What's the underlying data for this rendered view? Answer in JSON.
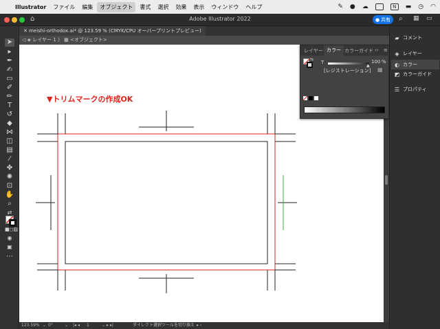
{
  "menubar": {
    "app": "Illustrator",
    "items": [
      "ファイル",
      "編集",
      "オブジェクト",
      "書式",
      "選択",
      "効果",
      "表示",
      "ウィンドウ",
      "ヘルプ"
    ],
    "active_index": 2
  },
  "window": {
    "title": "Adobe Illustrator 2022",
    "share_label": "共有"
  },
  "document": {
    "tab_label": "meishi-orthodox.ai* @ 123.59 % (CMYK/CPU オーバープリントプレビュー)",
    "breadcrumb_layer": "レイヤー 1",
    "breadcrumb_object": "<オブジェクト>"
  },
  "canvas": {
    "annotation": "▼トリムマークの作成OK"
  },
  "color_panel": {
    "tabs": [
      "レイヤー",
      "カラー",
      "カラーガイド"
    ],
    "selected_tab": "カラー",
    "channel_label": "T",
    "value": "100",
    "unit": "%",
    "registration_label": "[レジストレーション]"
  },
  "dock": {
    "items": [
      {
        "label": "コメント",
        "icon": "comment-icon"
      },
      {
        "label": "レイヤー",
        "icon": "layers-icon"
      },
      {
        "label": "カラー",
        "icon": "color-icon"
      },
      {
        "label": "カラーガイド",
        "icon": "color-guide-icon"
      },
      {
        "label": "プロパティ",
        "icon": "properties-icon"
      }
    ]
  },
  "statusbar": {
    "zoom": "123.59%",
    "rotation": "0°",
    "artboard": "1",
    "tool_hint": "ダイレクト選択ツールを切り換え"
  },
  "colors": {
    "trim_red": "#e0201a",
    "accent_blue": "#1473e6",
    "guide_green": "#3cae3c"
  }
}
